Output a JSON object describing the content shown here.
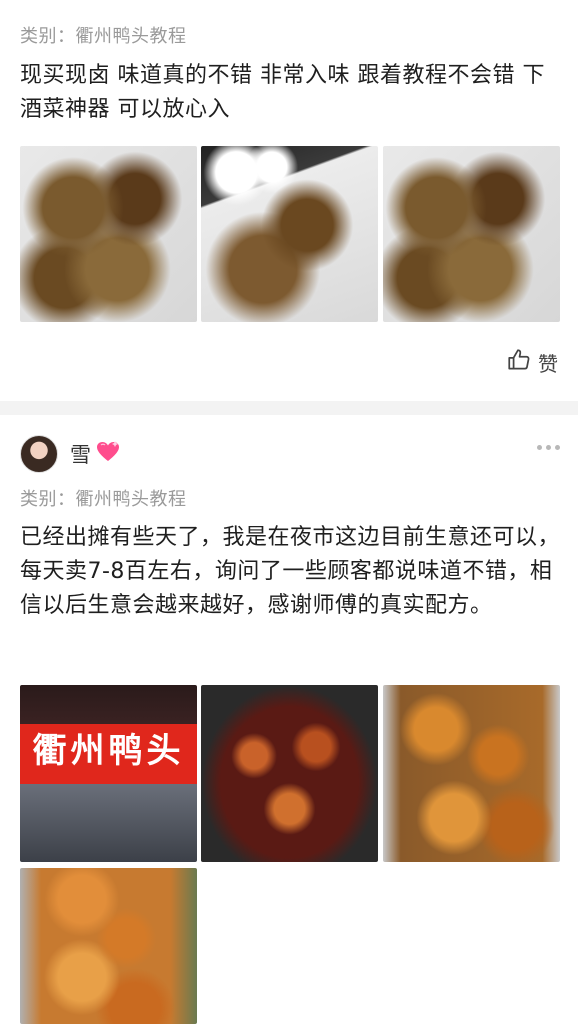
{
  "post1": {
    "category": "类别：衢州鸭头教程",
    "body": "现买现卤 味道真的不错 非常入味 跟着教程不会错 下酒菜神器 可以放心入",
    "like_label": "赞"
  },
  "post2": {
    "username": "雪",
    "category": "类别：衢州鸭头教程",
    "body": "已经出摊有些天了，我是在夜市这边目前生意还可以，每天卖7-8百左右，询问了一些顾客都说味道不错，相信以后生意会越来越好，感谢师傅的真实配方。",
    "shop_sign": "衢州鸭头"
  },
  "colors": {
    "accent_heart": "#ff4d8d",
    "sign_red": "#e0271c"
  },
  "icons": {
    "like": "thumbs-up-icon",
    "heart": "sparkling-heart-icon",
    "more": "more-dots-icon"
  }
}
